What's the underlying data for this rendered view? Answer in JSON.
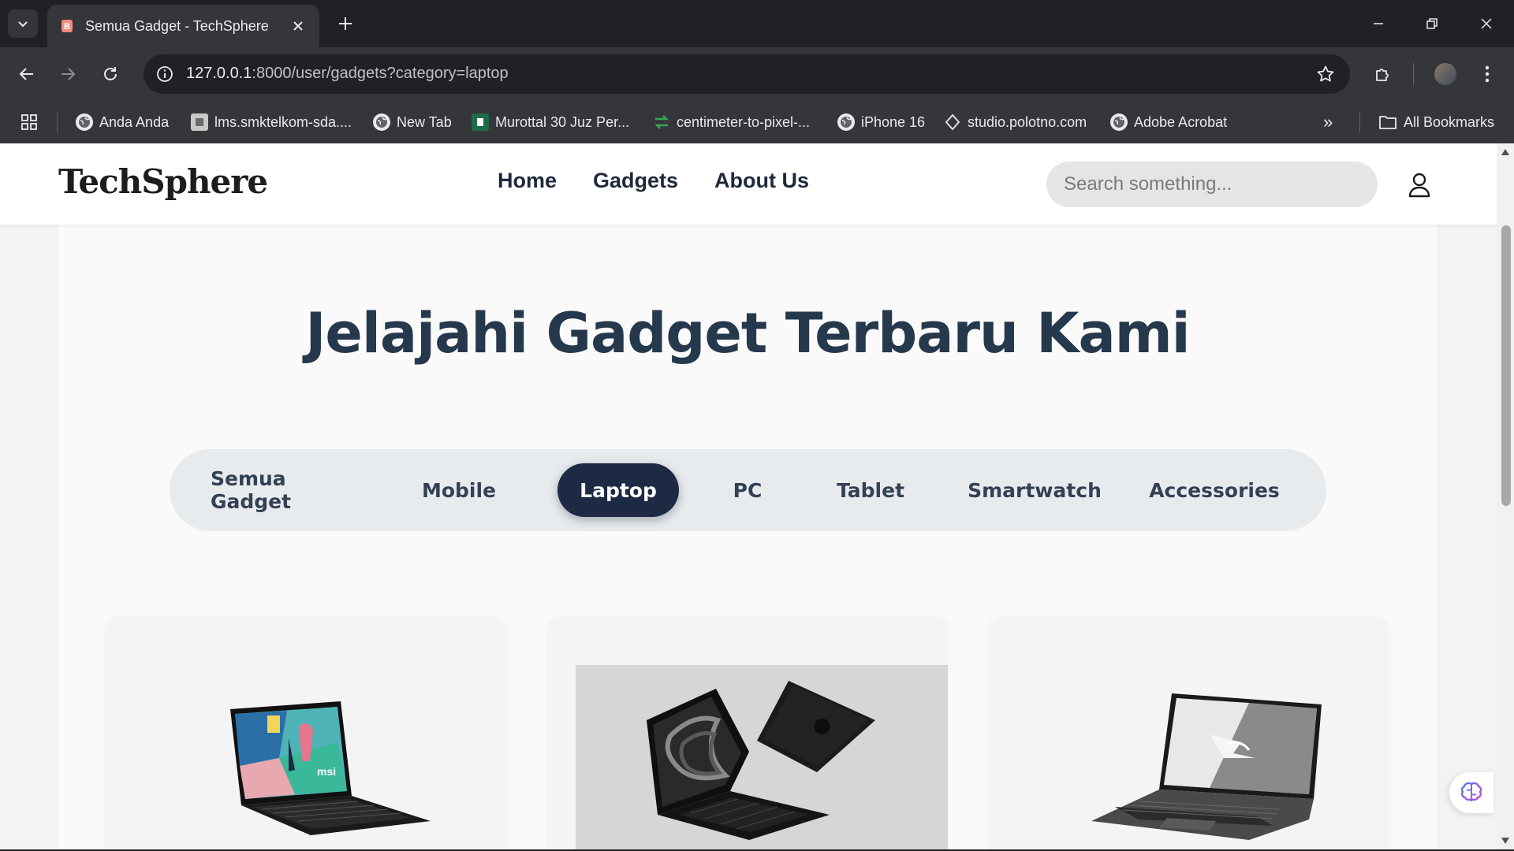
{
  "browser": {
    "tab_title": "Semua Gadget - TechSphere",
    "url_host": "127.0.0.1",
    "url_rest": ":8000/user/gadgets?category=laptop",
    "bookmarks": [
      {
        "label": "Anda Anda",
        "icon": "globe-icon"
      },
      {
        "label": "lms.smktelkom-sda....",
        "icon": "site-icon"
      },
      {
        "label": "New Tab",
        "icon": "globe-icon"
      },
      {
        "label": "Murottal 30 Juz Per...",
        "icon": "book-icon"
      },
      {
        "label": "centimeter-to-pixel-...",
        "icon": "convert-icon"
      },
      {
        "label": "iPhone 16",
        "icon": "globe-icon"
      },
      {
        "label": "studio.polotno.com",
        "icon": "polotno-icon"
      },
      {
        "label": "Adobe Acrobat",
        "icon": "globe-icon"
      }
    ],
    "all_bookmarks": "All Bookmarks",
    "overflow": "»"
  },
  "site": {
    "logo": "TechSphere",
    "nav": [
      "Home",
      "Gadgets",
      "About Us"
    ],
    "search_placeholder": "Search something..."
  },
  "hero": {
    "title": "Jelajahi Gadget Terbaru Kami"
  },
  "categories": [
    {
      "label": "Semua Gadget",
      "active": false
    },
    {
      "label": "Mobile",
      "active": false
    },
    {
      "label": "Laptop",
      "active": true
    },
    {
      "label": "PC",
      "active": false
    },
    {
      "label": "Tablet",
      "active": false
    },
    {
      "label": "Smartwatch",
      "active": false
    },
    {
      "label": "Accessories",
      "active": false
    }
  ],
  "products": [
    {
      "image": "msi-laptop-image"
    },
    {
      "image": "macbook-pro-black-image"
    },
    {
      "image": "asus-rog-laptop-image"
    }
  ],
  "colors": {
    "active_category_bg": "#1e2a44",
    "title_color": "#26384c",
    "chrome_dark": "#202124",
    "chrome_toolbar": "#35363a"
  }
}
